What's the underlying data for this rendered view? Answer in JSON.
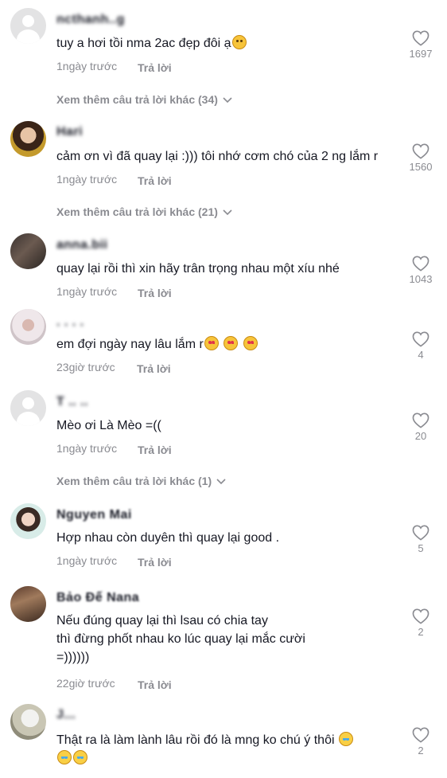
{
  "comments": [
    {
      "username": "ncthanh..g",
      "text": "tuy a hơi tồi nma 2ac đẹp đôi ạ",
      "text_emoji": "🙄",
      "time": "1ngày trước",
      "reply_label": "Trả lời",
      "likes": "1697",
      "more_replies": "Xem thêm câu trả lời khác (34)"
    },
    {
      "username": "Hari",
      "text": "cảm ơn vì đã quay lại :))) tôi nhớ cơm chó của 2 ng lắm r",
      "time": "1ngày trước",
      "reply_label": "Trả lời",
      "likes": "1560",
      "more_replies": "Xem thêm câu trả lời khác (21)"
    },
    {
      "username": "anna.bii",
      "text": "quay lại rồi thì xin hãy trân trọng nhau một xíu nhé",
      "time": "1ngày trước",
      "reply_label": "Trả lời",
      "likes": "1043"
    },
    {
      "username": ". . . .",
      "text": "em đợi ngày nay lâu lắm r",
      "text_emoji": "🥰🥰🥰",
      "time": "23giờ trước",
      "reply_label": "Trả lời",
      "likes": "4"
    },
    {
      "username": "T .. ..",
      "text": "Mèo ơi Là Mèo =((",
      "time": "1ngày trước",
      "reply_label": "Trả lời",
      "likes": "20",
      "more_replies": "Xem thêm câu trả lời khác (1)"
    },
    {
      "username": "Nguyen Mai",
      "text": "Hợp nhau còn duyên thì quay lại good .",
      "time": "1ngày trước",
      "reply_label": "Trả lời",
      "likes": "5"
    },
    {
      "username": "Bảo Đế Nana",
      "text_line1": "Nếu đúng quay lại thì lsau có chia tay",
      "text_line2": "thì đừng phốt nhau ko lúc quay lại mắc cười",
      "text_line3": "=))))))",
      "time": "22giờ trước",
      "reply_label": "Trả lời",
      "likes": "2"
    },
    {
      "username": "J...",
      "text": "Thật ra là làm lành lâu rồi đó là mng ko chú ý thôi",
      "text_emoji": "😂😂😂",
      "likes": "2"
    }
  ]
}
